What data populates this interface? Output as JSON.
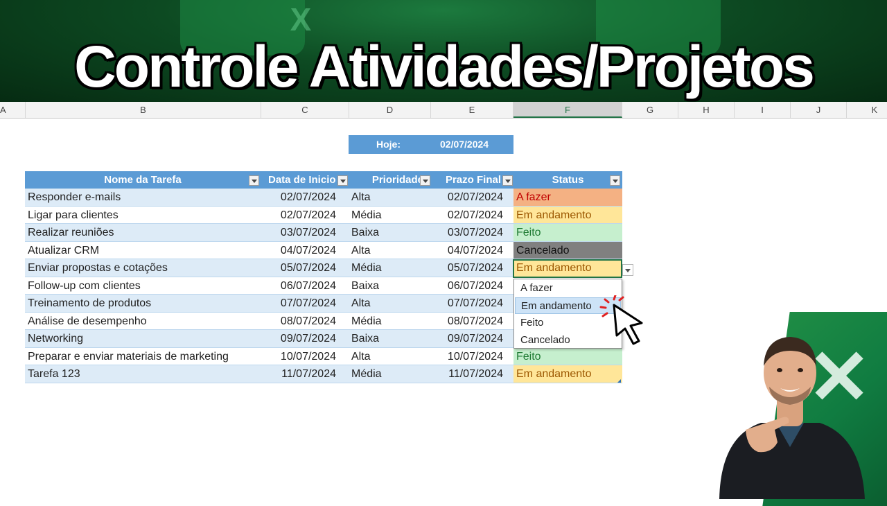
{
  "banner": {
    "title": "Controle Atividades/Projetos",
    "excel_icon_letter": "X"
  },
  "columns": [
    "A",
    "B",
    "C",
    "D",
    "E",
    "F",
    "G",
    "H",
    "I",
    "J",
    "K"
  ],
  "selected_column": "F",
  "hoje": {
    "label": "Hoje:",
    "value": "02/07/2024"
  },
  "table": {
    "headers": [
      "Nome da Tarefa",
      "Data de Inicio",
      "Prioridade",
      "Prazo Final",
      "Status"
    ],
    "rows": [
      {
        "nome": "Responder e-mails",
        "inicio": "02/07/2024",
        "prioridade": "Alta",
        "prazo": "02/07/2024",
        "status": "A fazer"
      },
      {
        "nome": "Ligar para clientes",
        "inicio": "02/07/2024",
        "prioridade": "Média",
        "prazo": "02/07/2024",
        "status": "Em andamento"
      },
      {
        "nome": "Realizar reuniões",
        "inicio": "03/07/2024",
        "prioridade": "Baixa",
        "prazo": "03/07/2024",
        "status": "Feito"
      },
      {
        "nome": "Atualizar CRM",
        "inicio": "04/07/2024",
        "prioridade": "Alta",
        "prazo": "04/07/2024",
        "status": "Cancelado"
      },
      {
        "nome": "Enviar propostas e cotações",
        "inicio": "05/07/2024",
        "prioridade": "Média",
        "prazo": "05/07/2024",
        "status": "Em andamento"
      },
      {
        "nome": "Follow-up com clientes",
        "inicio": "06/07/2024",
        "prioridade": "Baixa",
        "prazo": "06/07/2024",
        "status": ""
      },
      {
        "nome": "Treinamento de produtos",
        "inicio": "07/07/2024",
        "prioridade": "Alta",
        "prazo": "07/07/2024",
        "status": ""
      },
      {
        "nome": "Análise de desempenho",
        "inicio": "08/07/2024",
        "prioridade": "Média",
        "prazo": "08/07/2024",
        "status": ""
      },
      {
        "nome": "Networking",
        "inicio": "09/07/2024",
        "prioridade": "Baixa",
        "prazo": "09/07/2024",
        "status": ""
      },
      {
        "nome": "Preparar e enviar materiais de marketing",
        "inicio": "10/07/2024",
        "prioridade": "Alta",
        "prazo": "10/07/2024",
        "status": "Feito"
      },
      {
        "nome": "Tarefa 123",
        "inicio": "11/07/2024",
        "prioridade": "Média",
        "prazo": "11/07/2024",
        "status": "Em andamento"
      }
    ]
  },
  "status_colors": {
    "A fazer": "#f4b183",
    "Em andamento": "#ffe699",
    "Feito": "#c6efce",
    "Cancelado": "#808080"
  },
  "dropdown": {
    "options": [
      "A fazer",
      "Em andamento",
      "Feito",
      "Cancelado"
    ],
    "highlighted": "Em andamento"
  }
}
